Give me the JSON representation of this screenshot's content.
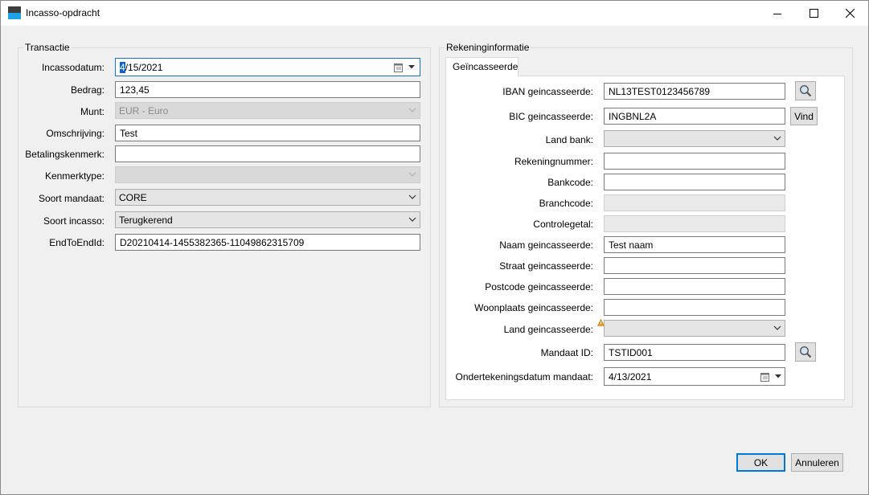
{
  "window": {
    "title": "Incasso-opdracht"
  },
  "transactie": {
    "group_title": "Transactie",
    "incassodatum": {
      "label": "Incassodatum:",
      "selected_part": "4",
      "rest": "/15/2021"
    },
    "bedrag": {
      "label": "Bedrag:",
      "value": "123,45"
    },
    "munt": {
      "label": "Munt:",
      "value": "EUR - Euro"
    },
    "omschrijving": {
      "label": "Omschrijving:",
      "value": "Test"
    },
    "betalingskenmerk": {
      "label": "Betalingskenmerk:",
      "value": ""
    },
    "kenmerktype": {
      "label": "Kenmerktype:",
      "value": ""
    },
    "soort_mandaat": {
      "label": "Soort mandaat:",
      "value": "CORE"
    },
    "soort_incasso": {
      "label": "Soort incasso:",
      "value": "Terugkerend"
    },
    "endtoendid": {
      "label": "EndToEndId:",
      "value": "D20210414-1455382365-11049862315709"
    }
  },
  "rekening": {
    "group_title": "Rekeninginformatie",
    "tab_label": "Geïncasseerde",
    "iban": {
      "label": "IBAN geincasseerde:",
      "value": "NL13TEST0123456789"
    },
    "bic": {
      "label": "BIC geincasseerde:",
      "value": "INGBNL2A",
      "button": "Vind"
    },
    "land_bank": {
      "label": "Land bank:",
      "value": ""
    },
    "rekeningnummer": {
      "label": "Rekeningnummer:",
      "value": ""
    },
    "bankcode": {
      "label": "Bankcode:",
      "value": ""
    },
    "branchcode": {
      "label": "Branchcode:",
      "value": ""
    },
    "controlegetal": {
      "label": "Controlegetal:",
      "value": ""
    },
    "naam": {
      "label": "Naam geincasseerde:",
      "value": "Test naam"
    },
    "straat": {
      "label": "Straat geincasseerde:",
      "value": ""
    },
    "postcode": {
      "label": "Postcode geincasseerde:",
      "value": ""
    },
    "woonplaats": {
      "label": "Woonplaats geincasseerde:",
      "value": ""
    },
    "land": {
      "label": "Land geincasseerde:",
      "value": ""
    },
    "mandaat_id": {
      "label": "Mandaat ID:",
      "value": "TSTID001"
    },
    "ondertekeningsdatum": {
      "label": "Ondertekeningsdatum mandaat:",
      "value": "4/13/2021"
    }
  },
  "buttons": {
    "ok": "OK",
    "cancel": "Annuleren"
  },
  "colors": {
    "accent": "#0078d7",
    "selection": "#0a64c8",
    "warning": "#f0a020"
  }
}
